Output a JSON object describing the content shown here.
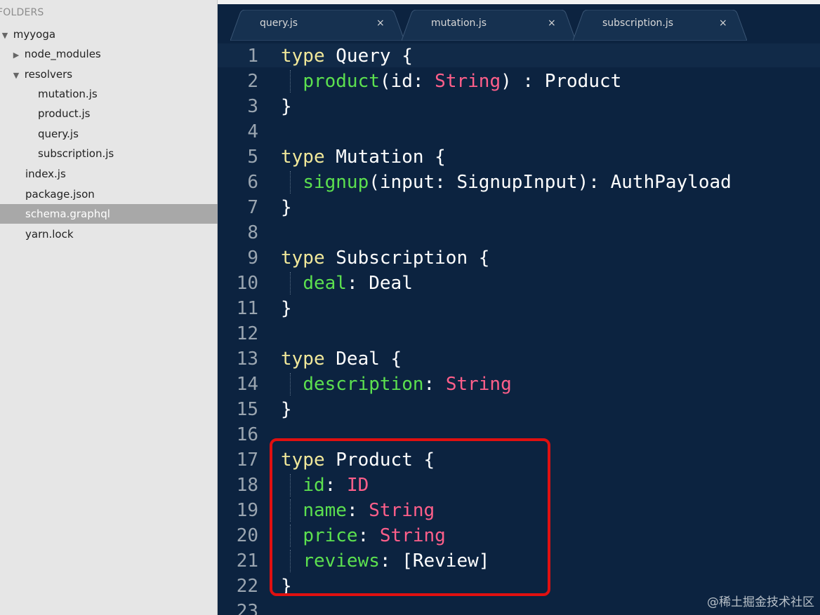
{
  "sidebar": {
    "header": "FOLDERS",
    "tree": [
      {
        "label": "myyoga",
        "arrow": "▼",
        "indent": 0,
        "selected": false
      },
      {
        "label": "node_modules",
        "arrow": "▶",
        "indent": 1,
        "selected": false
      },
      {
        "label": "resolvers",
        "arrow": "▼",
        "indent": 1,
        "selected": false
      },
      {
        "label": "mutation.js",
        "arrow": "",
        "indent": 2,
        "selected": false
      },
      {
        "label": "product.js",
        "arrow": "",
        "indent": 2,
        "selected": false
      },
      {
        "label": "query.js",
        "arrow": "",
        "indent": 2,
        "selected": false
      },
      {
        "label": "subscription.js",
        "arrow": "",
        "indent": 2,
        "selected": false
      },
      {
        "label": "index.js",
        "arrow": "",
        "indent": 1,
        "selected": false
      },
      {
        "label": "package.json",
        "arrow": "",
        "indent": 1,
        "selected": false
      },
      {
        "label": "schema.graphql",
        "arrow": "",
        "indent": 1,
        "selected": true
      },
      {
        "label": "yarn.lock",
        "arrow": "",
        "indent": 1,
        "selected": false
      }
    ]
  },
  "tabs": [
    {
      "label": "query.js",
      "close": "×"
    },
    {
      "label": "mutation.js",
      "close": "×"
    },
    {
      "label": "subscription.js",
      "close": "×"
    }
  ],
  "code_lines": [
    {
      "n": "1",
      "tokens": [
        [
          "kw",
          "type"
        ],
        [
          "pl",
          " Query {"
        ]
      ]
    },
    {
      "n": "2",
      "tokens": [
        [
          "pl",
          "  "
        ],
        [
          "fld",
          "product"
        ],
        [
          "pl",
          "(id: "
        ],
        [
          "typ",
          "String"
        ],
        [
          "pl",
          ") : Product"
        ]
      ]
    },
    {
      "n": "3",
      "tokens": [
        [
          "pl",
          "}"
        ]
      ]
    },
    {
      "n": "4",
      "tokens": []
    },
    {
      "n": "5",
      "tokens": [
        [
          "kw",
          "type"
        ],
        [
          "pl",
          " Mutation {"
        ]
      ]
    },
    {
      "n": "6",
      "tokens": [
        [
          "pl",
          "  "
        ],
        [
          "fld",
          "signup"
        ],
        [
          "pl",
          "(input: SignupInput): AuthPayload"
        ]
      ]
    },
    {
      "n": "7",
      "tokens": [
        [
          "pl",
          "}"
        ]
      ]
    },
    {
      "n": "8",
      "tokens": []
    },
    {
      "n": "9",
      "tokens": [
        [
          "kw",
          "type"
        ],
        [
          "pl",
          " Subscription {"
        ]
      ]
    },
    {
      "n": "10",
      "tokens": [
        [
          "pl",
          "  "
        ],
        [
          "fld",
          "deal"
        ],
        [
          "pl",
          ": Deal"
        ]
      ]
    },
    {
      "n": "11",
      "tokens": [
        [
          "pl",
          "}"
        ]
      ]
    },
    {
      "n": "12",
      "tokens": []
    },
    {
      "n": "13",
      "tokens": [
        [
          "kw",
          "type"
        ],
        [
          "pl",
          " Deal {"
        ]
      ]
    },
    {
      "n": "14",
      "tokens": [
        [
          "pl",
          "  "
        ],
        [
          "fld",
          "description"
        ],
        [
          "pl",
          ": "
        ],
        [
          "typ",
          "String"
        ]
      ]
    },
    {
      "n": "15",
      "tokens": [
        [
          "pl",
          "}"
        ]
      ]
    },
    {
      "n": "16",
      "tokens": []
    },
    {
      "n": "17",
      "tokens": [
        [
          "kw",
          "type"
        ],
        [
          "pl",
          " Product {"
        ]
      ]
    },
    {
      "n": "18",
      "tokens": [
        [
          "pl",
          "  "
        ],
        [
          "fld",
          "id"
        ],
        [
          "pl",
          ": "
        ],
        [
          "typ",
          "ID"
        ]
      ]
    },
    {
      "n": "19",
      "tokens": [
        [
          "pl",
          "  "
        ],
        [
          "fld",
          "name"
        ],
        [
          "pl",
          ": "
        ],
        [
          "typ",
          "String"
        ]
      ]
    },
    {
      "n": "20",
      "tokens": [
        [
          "pl",
          "  "
        ],
        [
          "fld",
          "price"
        ],
        [
          "pl",
          ": "
        ],
        [
          "typ",
          "String"
        ]
      ]
    },
    {
      "n": "21",
      "tokens": [
        [
          "pl",
          "  "
        ],
        [
          "fld",
          "reviews"
        ],
        [
          "pl",
          ": [Review]"
        ]
      ]
    },
    {
      "n": "22",
      "tokens": [
        [
          "pl",
          "}"
        ]
      ]
    },
    {
      "n": "23",
      "tokens": []
    }
  ],
  "watermark": "@稀土掘金技术社区",
  "colors": {
    "editor_bg": "#0c2340",
    "keyword": "#f1e89a",
    "field": "#5ce04f",
    "type": "#ff5f8a",
    "highlight_border": "#e01010"
  }
}
